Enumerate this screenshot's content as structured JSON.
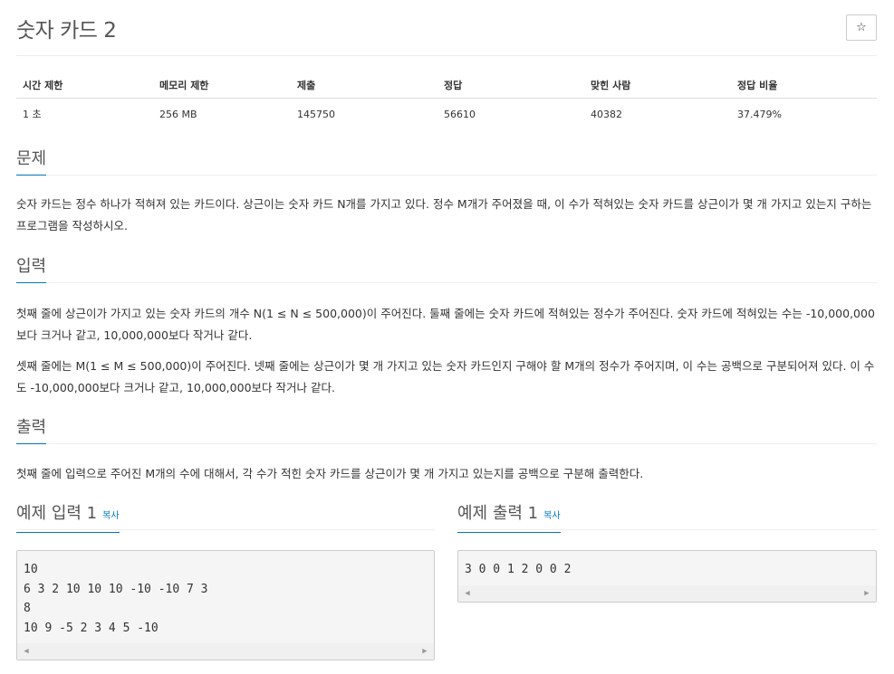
{
  "problem": {
    "title": "숫자 카드 2",
    "star_icon": "☆"
  },
  "info_table": {
    "headers": [
      "시간 제한",
      "메모리 제한",
      "제출",
      "정답",
      "맞힌 사람",
      "정답 비율"
    ],
    "values": [
      "1 초",
      "256 MB",
      "145750",
      "56610",
      "40382",
      "37.479%"
    ]
  },
  "sections": {
    "problem": {
      "heading": "문제",
      "text": "숫자 카드는 정수 하나가 적혀져 있는 카드이다. 상근이는 숫자 카드 N개를 가지고 있다. 정수 M개가 주어졌을 때, 이 수가 적혀있는 숫자 카드를 상근이가 몇 개 가지고 있는지 구하는 프로그램을 작성하시오."
    },
    "input": {
      "heading": "입력",
      "text1": "첫째 줄에 상근이가 가지고 있는 숫자 카드의 개수 N(1 ≤ N ≤ 500,000)이 주어진다. 둘째 줄에는 숫자 카드에 적혀있는 정수가 주어진다. 숫자 카드에 적혀있는 수는 -10,000,000보다 크거나 같고, 10,000,000보다 작거나 같다.",
      "text2": "셋째 줄에는 M(1 ≤ M ≤ 500,000)이 주어진다. 넷째 줄에는 상근이가 몇 개 가지고 있는 숫자 카드인지 구해야 할 M개의 정수가 주어지며, 이 수는 공백으로 구분되어져 있다. 이 수도 -10,000,000보다 크거나 같고, 10,000,000보다 작거나 같다."
    },
    "output": {
      "heading": "출력",
      "text": "첫째 줄에 입력으로 주어진 M개의 수에 대해서, 각 수가 적힌 숫자 카드를 상근이가 몇 개 가지고 있는지를 공백으로 구분해 출력한다."
    }
  },
  "samples": {
    "input": {
      "heading": "예제 입력 1",
      "copy_label": "복사",
      "content": "10\n6 3 2 10 10 10 -10 -10 7 3\n8\n10 9 -5 2 3 4 5 -10"
    },
    "output": {
      "heading": "예제 출력 1",
      "copy_label": "복사",
      "content": "3 0 0 1 2 0 0 2"
    }
  },
  "scroll_icons": {
    "left": "◀",
    "right": "▶"
  }
}
